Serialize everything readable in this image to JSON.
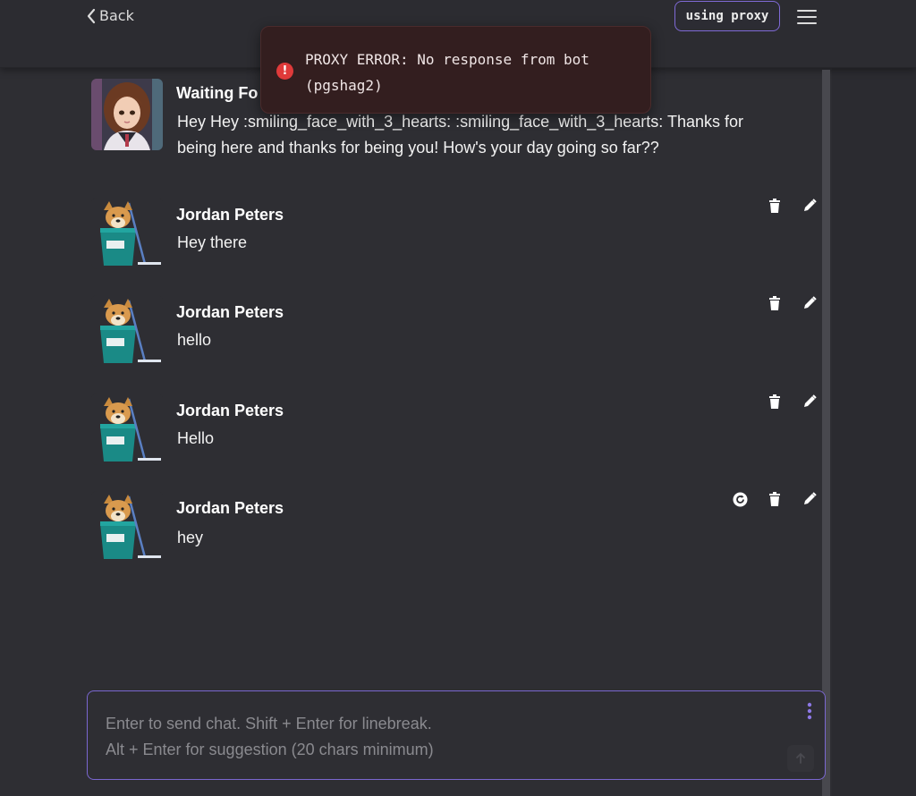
{
  "nav": {
    "back_label": "Back",
    "proxy_label": "using proxy"
  },
  "error": {
    "message": "PROXY ERROR: No response from bot (pgshag2)",
    "icon": "exclamation-circle-icon",
    "color": "#e03a3a"
  },
  "bot_message": {
    "name": "Waiting Fo",
    "text": "Hey Hey :smiling_face_with_3_hearts: :smiling_face_with_3_hearts: Thanks for being here and thanks for being you! How's your day going so far??"
  },
  "messages": [
    {
      "name": "Jordan Peters",
      "text": "Hey there"
    },
    {
      "name": "Jordan Peters",
      "text": "hello"
    },
    {
      "name": "Jordan Peters",
      "text": "Hello"
    },
    {
      "name": "Jordan Peters",
      "text": "hey"
    }
  ],
  "input": {
    "placeholder": "Enter to send chat. Shift + Enter for linebreak.\nAlt + Enter for suggestion (20 chars minimum)"
  },
  "colors": {
    "accent": "#7a67d0",
    "background": "#2e2e33",
    "error_bg": "#331e1f"
  }
}
